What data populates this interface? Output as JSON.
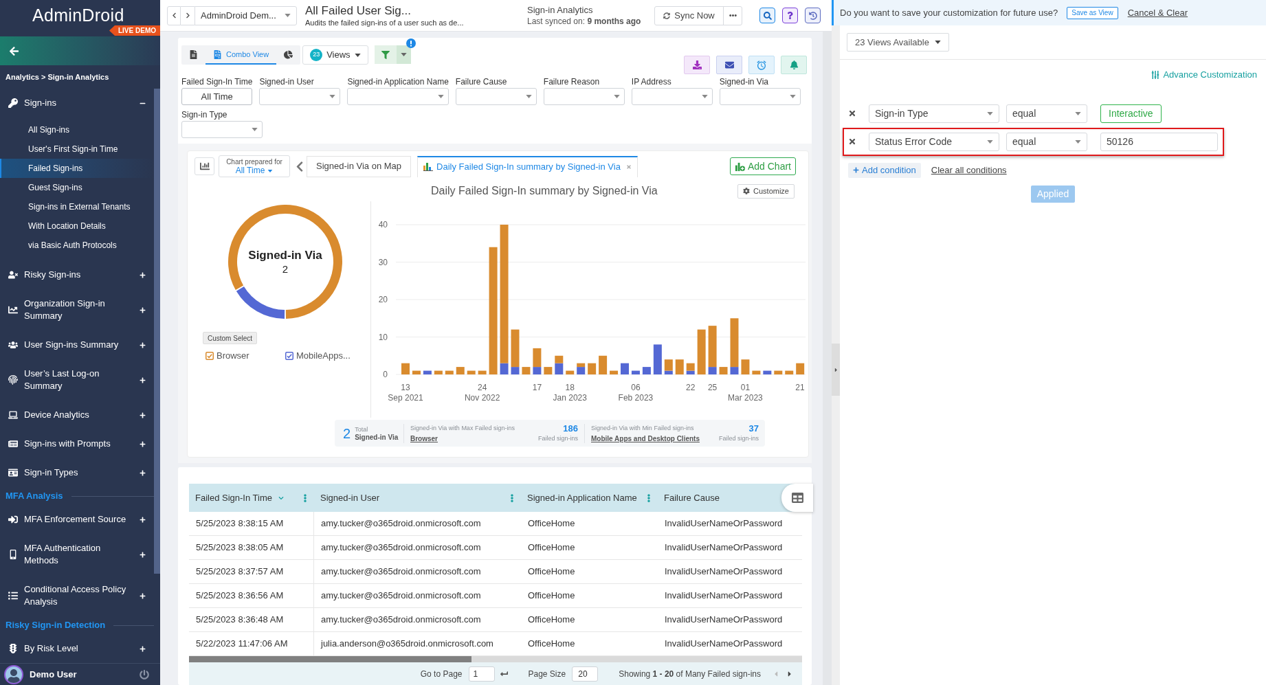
{
  "sidebar": {
    "logo": "AdminDroid",
    "badge": "LIVE DEMO",
    "breadcrumb": "Analytics > Sign-in Analytics",
    "nav": [
      {
        "kind": "group",
        "label": "Sign-ins",
        "expanded": true,
        "children": [
          {
            "label": "All Sign-ins",
            "selected": false
          },
          {
            "label": "User's First Sign-in Time",
            "selected": false
          },
          {
            "label": "Failed Sign-ins",
            "selected": true
          },
          {
            "label": "Guest Sign-ins",
            "selected": false
          },
          {
            "label": "Sign-ins in External Tenants",
            "selected": false
          },
          {
            "label": "With Location Details",
            "selected": false
          },
          {
            "label": "via Basic Auth Protocols",
            "selected": false
          }
        ]
      },
      {
        "kind": "group",
        "label": "Risky Sign-ins",
        "expanded": false
      },
      {
        "kind": "group",
        "label": "Organization Sign-in Summary",
        "expanded": false
      },
      {
        "kind": "group",
        "label": "User Sign-ins Summary",
        "expanded": false
      },
      {
        "kind": "group",
        "label": "User’s Last Log-on Summary",
        "expanded": false
      },
      {
        "kind": "group",
        "label": "Device Analytics",
        "expanded": false
      },
      {
        "kind": "group",
        "label": "Sign-ins with Prompts",
        "expanded": false
      },
      {
        "kind": "group",
        "label": "Sign-in Types",
        "expanded": false
      },
      {
        "kind": "section",
        "label": "MFA Analysis"
      },
      {
        "kind": "group",
        "label": "MFA Enforcement Source",
        "expanded": false
      },
      {
        "kind": "group",
        "label": "MFA Authentication Methods",
        "expanded": false
      },
      {
        "kind": "group",
        "label": "Conditional Access Policy Analysis",
        "expanded": false
      },
      {
        "kind": "section",
        "label": "Risky Sign-in Detection"
      },
      {
        "kind": "group",
        "label": "By Risk Level",
        "expanded": false
      }
    ],
    "user": {
      "name": "Demo User"
    }
  },
  "topbar": {
    "report_dropdown": "AdminDroid Dem...",
    "title": "All Failed User Sig...",
    "subtitle": "Audits the failed sign-ins of a user such as de...",
    "module": "Sign-in Analytics",
    "last_synced": "Last synced on: **9 months ago**",
    "sync_button": "Sync Now"
  },
  "toolbar": {
    "view_tabs": [
      {
        "kind": "report",
        "selected": false
      },
      {
        "kind": "combo",
        "label": "Combo View",
        "selected": true
      },
      {
        "kind": "chart",
        "selected": false
      }
    ],
    "views": {
      "count": "23",
      "label": "Views"
    }
  },
  "filters": [
    {
      "label": "Failed Sign-In Time",
      "kind": "button",
      "value": "All Time"
    },
    {
      "label": "Signed-in User",
      "kind": "select"
    },
    {
      "label": "Signed-in Application Name",
      "kind": "select"
    },
    {
      "label": "Failure Cause",
      "kind": "select"
    },
    {
      "label": "Failure Reason",
      "kind": "select"
    },
    {
      "label": "IP Address",
      "kind": "select"
    },
    {
      "label": "Signed-in Via",
      "kind": "select"
    },
    {
      "label": "Sign-in Type",
      "kind": "select"
    }
  ],
  "chart_panel": {
    "prepared_label": "Chart prepared for",
    "prepared_value": "All Time",
    "tabs": [
      {
        "label": "Signed-in Via on Map",
        "selected": false
      },
      {
        "label": "Daily Failed Sign-In summary by Signed-in Via",
        "selected": true
      }
    ],
    "add_button": "Add Chart",
    "customize_button": "Customize",
    "donut": {
      "center_value": "2",
      "chart_data": {
        "type": "donut",
        "title": "Signed-in Via",
        "values": [
          83.4,
          16.6
        ]
      }
    },
    "custom_select": "Custom Select",
    "legend": [
      {
        "label": "Browser",
        "checked": true,
        "color": "#d98b2e"
      },
      {
        "label": "MobileApps...",
        "checked": true,
        "color": "#5468d4"
      }
    ],
    "bar_chart": {
      "chart_data": {
        "type": "bar",
        "title": "Daily Failed Sign-In summary by Signed-in Via",
        "stacked": true,
        "grid": true,
        "categories": [
          "13 Sep 2021",
          null,
          null,
          null,
          null,
          null,
          null,
          "24 Nov 2022",
          null,
          null,
          null,
          null,
          "17",
          null,
          null,
          "18 Jan 2023",
          null,
          null,
          null,
          null,
          null,
          "06 Feb 2023",
          null,
          null,
          null,
          null,
          "22",
          null,
          "25",
          null,
          null,
          "01 Mar 2023",
          null,
          null,
          null,
          null,
          "21"
        ],
        "ylim": [
          0,
          40
        ],
        "yticks": [
          0,
          10,
          20,
          30,
          40
        ],
        "series": [
          {
            "color": "#5468d4",
            "values": [
              0,
              0,
              1,
              0,
              0,
              0,
              0,
              0,
              0,
              3,
              2,
              0,
              2,
              0,
              3,
              0,
              2,
              0,
              0,
              0,
              3,
              1,
              2,
              8,
              1,
              0,
              1,
              0,
              2,
              0,
              2,
              0,
              0,
              1,
              0,
              0,
              0
            ]
          },
          {
            "color": "#d98b2e",
            "values": [
              3,
              1,
              0,
              1,
              1,
              2,
              1,
              1,
              34,
              37,
              10,
              2,
              5,
              2,
              2,
              1,
              1,
              3,
              5,
              1,
              0,
              0,
              0,
              0,
              3,
              4,
              2,
              12,
              11,
              2,
              13,
              4,
              1,
              0,
              1,
              1,
              3
            ]
          }
        ]
      }
    },
    "summary": {
      "total_value": "2",
      "total_caption": "Total",
      "total_label": "Signed-in Via",
      "stats": [
        {
          "caption": "Signed-in Via with Max Failed sign-ins",
          "name": "Browser",
          "count": "186",
          "unit": "Failed sign-ins"
        },
        {
          "caption": "Signed-in Via with Min Failed sign-ins",
          "name": "Mobile Apps and Desktop Clients",
          "count": "37",
          "unit": "Failed sign-ins"
        }
      ]
    }
  },
  "table": {
    "columns": [
      {
        "label": "Failed Sign-In Time",
        "sorted": true,
        "menu": true
      },
      {
        "label": "Signed-in User",
        "sorted": false,
        "menu": true
      },
      {
        "label": "Signed-in Application Name",
        "sorted": false,
        "menu": true
      },
      {
        "label": "Failure Cause",
        "sorted": false,
        "menu": false
      }
    ],
    "rows": [
      [
        "5/25/2023 8:38:15 AM",
        "amy.tucker@o365droid.onmicrosoft.com",
        "OfficeHome",
        "InvalidUserNameOrPassword"
      ],
      [
        "5/25/2023 8:38:05 AM",
        "amy.tucker@o365droid.onmicrosoft.com",
        "OfficeHome",
        "InvalidUserNameOrPassword"
      ],
      [
        "5/25/2023 8:37:57 AM",
        "amy.tucker@o365droid.onmicrosoft.com",
        "OfficeHome",
        "InvalidUserNameOrPassword"
      ],
      [
        "5/25/2023 8:36:56 AM",
        "amy.tucker@o365droid.onmicrosoft.com",
        "OfficeHome",
        "InvalidUserNameOrPassword"
      ],
      [
        "5/25/2023 8:36:48 AM",
        "amy.tucker@o365droid.onmicrosoft.com",
        "OfficeHome",
        "InvalidUserNameOrPassword"
      ],
      [
        "5/22/2023 11:47:06 AM",
        "julia.anderson@o365droid.onmicrosoft.com",
        "OfficeHome",
        "InvalidUserNameOrPassword"
      ]
    ]
  },
  "pagination": {
    "goto_label": "Go to Page",
    "page": "1",
    "size_label": "Page Size",
    "page_size": "20",
    "summary": "Showing **1 - 20** of Many Failed sign-ins"
  },
  "customize_panel": {
    "banner": {
      "question": "Do you want to save your customization for future use?",
      "save_button": "Save as View",
      "cancel_link": "Cancel & Clear"
    },
    "views_dropdown": "23 Views Available",
    "advance_link": "Advance Customization",
    "conditions": [
      {
        "field": "Sign-in Type",
        "operator": "equal",
        "kind": "tag",
        "value": "Interactive",
        "highlighted": false
      },
      {
        "field": "Status Error Code",
        "operator": "equal",
        "kind": "input",
        "value": "50126",
        "highlighted": true
      }
    ],
    "add_condition": "Add condition",
    "clear_link": "Clear all conditions",
    "apply_button": "Applied",
    "apply_disabled": true
  }
}
